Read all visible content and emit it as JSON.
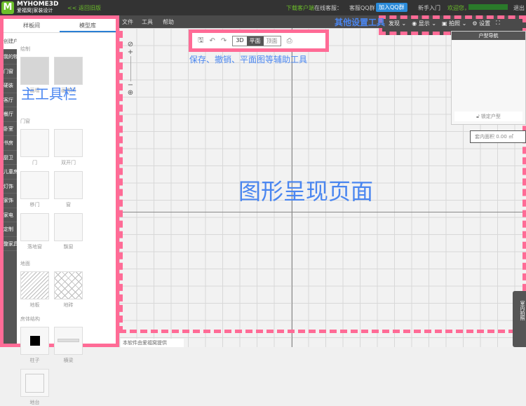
{
  "header": {
    "logo_letter": "M",
    "brand": "MYHOME3D",
    "brand_sub": "爱福窝|家装设计",
    "back_link": "<< 返回旧版",
    "download": "下载客户端",
    "online_service": "在线客服：",
    "qq_group": "客服QQ群：",
    "join_qq": "加入QQ群",
    "beginner": "新手入门",
    "welcome": "欢迎您，",
    "logout": "退出"
  },
  "menu": {
    "file": "文件",
    "tools": "工具",
    "help": "帮助"
  },
  "settings": {
    "discover": "发现",
    "display": "显示",
    "photo": "拍照",
    "settings": "设置"
  },
  "sidebar": {
    "tabs": [
      "样板间",
      "模型库"
    ],
    "categories": [
      "创建户型",
      "我的物品",
      "门窗",
      "硬装",
      "客厅",
      "餐厅",
      "卧室",
      "书房",
      "厨卫",
      "儿童房",
      "灯饰",
      "家饰",
      "家电",
      "定制",
      "整家具"
    ],
    "sections": [
      {
        "title": "绘制",
        "items": [
          "画墙",
          "画房间"
        ]
      },
      {
        "title": "门窗",
        "items": [
          "门",
          "双开门",
          "移门",
          "窗",
          "落地窗",
          "飘窗"
        ]
      },
      {
        "title": "地面",
        "items": [
          "地板",
          "地砖"
        ]
      },
      {
        "title": "房体结构",
        "items": [
          "柱子",
          "横梁",
          "地台"
        ]
      }
    ]
  },
  "toolbar": {
    "view_3d": "3D",
    "view_plan": "平面",
    "view_top": "顶面"
  },
  "nav_panel": {
    "title": "户型导航",
    "lock": "锁定户型"
  },
  "area": {
    "label": "套内面积",
    "value": "0.00 ㎡"
  },
  "footer": {
    "text": "本软件由爱福窝提供"
  },
  "screenshot_tab": {
    "label": "室内拍照"
  },
  "annotations": {
    "main_toolbar": "主工具栏",
    "aux_tools": "保存、撤销、平面图等辅助工具",
    "other_settings": "其他设置工具",
    "canvas": "图形呈现页面"
  }
}
